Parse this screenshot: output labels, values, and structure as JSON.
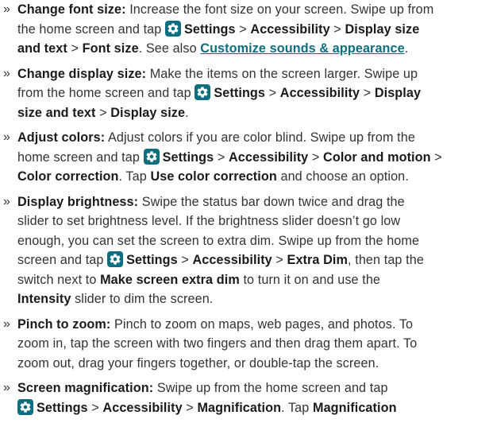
{
  "bullet_glyph": "»",
  "items": [
    {
      "lines": [
        [
          {
            "t": "Change font size:",
            "b": true
          },
          {
            "t": " Increase the font size on your screen. Swipe up from"
          }
        ],
        [
          {
            "t": "the home screen and tap "
          },
          {
            "icon": "settings-gear-icon"
          },
          {
            "t": "Settings",
            "b": true
          },
          {
            "t": " > "
          },
          {
            "t": "Accessibility",
            "b": true
          },
          {
            "t": " > "
          },
          {
            "t": "Display size",
            "b": true
          }
        ],
        [
          {
            "t": "and text",
            "b": true
          },
          {
            "t": " > "
          },
          {
            "t": "Font size",
            "b": true
          },
          {
            "t": ". See also "
          },
          {
            "t": "Customize sounds & appearance",
            "link": true
          },
          {
            "t": "."
          }
        ]
      ]
    },
    {
      "lines": [
        [
          {
            "t": "Change display size:",
            "b": true
          },
          {
            "t": " Make the items on the screen larger. Swipe up"
          }
        ],
        [
          {
            "t": "from the home screen and tap "
          },
          {
            "icon": "settings-gear-icon"
          },
          {
            "t": "Settings",
            "b": true
          },
          {
            "t": " > "
          },
          {
            "t": "Accessibility",
            "b": true
          },
          {
            "t": " > "
          },
          {
            "t": "Display",
            "b": true
          }
        ],
        [
          {
            "t": "size and text",
            "b": true
          },
          {
            "t": " > "
          },
          {
            "t": "Display size",
            "b": true
          },
          {
            "t": "."
          }
        ]
      ]
    },
    {
      "lines": [
        [
          {
            "t": "Adjust colors:",
            "b": true
          },
          {
            "t": " Adjust colors if you are color blind. Swipe up from the"
          }
        ],
        [
          {
            "t": "home screen and tap "
          },
          {
            "icon": "settings-gear-icon"
          },
          {
            "t": "Settings",
            "b": true
          },
          {
            "t": " > "
          },
          {
            "t": "Accessibility",
            "b": true
          },
          {
            "t": " > "
          },
          {
            "t": "Color and motion",
            "b": true
          },
          {
            "t": " >"
          }
        ],
        [
          {
            "t": "Color correction",
            "b": true
          },
          {
            "t": ". Tap "
          },
          {
            "t": "Use color correction",
            "b": true
          },
          {
            "t": " and choose an option."
          }
        ]
      ]
    },
    {
      "lines": [
        [
          {
            "t": "Display brightness:",
            "b": true
          },
          {
            "t": " Swipe the status bar down twice and drag the"
          }
        ],
        [
          {
            "t": "slider to set brightness level. If the brightness slider doesn’t go low"
          }
        ],
        [
          {
            "t": "enough, you can set the screen to extra dim. Swipe up from the home"
          }
        ],
        [
          {
            "t": "screen and tap "
          },
          {
            "icon": "settings-gear-icon"
          },
          {
            "t": "Settings",
            "b": true
          },
          {
            "t": " > "
          },
          {
            "t": "Accessibility",
            "b": true
          },
          {
            "t": " > "
          },
          {
            "t": "Extra Dim",
            "b": true
          },
          {
            "t": ", then tap the"
          }
        ],
        [
          {
            "t": "switch next to "
          },
          {
            "t": "Make screen extra dim",
            "b": true
          },
          {
            "t": " to turn it on and use the"
          }
        ],
        [
          {
            "t": "Intensity",
            "b": true
          },
          {
            "t": " slider to dim the screen."
          }
        ]
      ]
    },
    {
      "lines": [
        [
          {
            "t": "Pinch to zoom:",
            "b": true
          },
          {
            "t": " Pinch to zoom on maps, web pages, and photos. To"
          }
        ],
        [
          {
            "t": "zoom in, tap the screen with two fingers and then drag them apart. To"
          }
        ],
        [
          {
            "t": "zoom out, drag your fingers together, or double-tap the screen."
          }
        ]
      ]
    },
    {
      "lines": [
        [
          {
            "t": "Screen magnification:",
            "b": true
          },
          {
            "t": " Swipe up from the home screen and tap"
          }
        ],
        [
          {
            "icon": "settings-gear-icon"
          },
          {
            "t": "Settings",
            "b": true
          },
          {
            "t": " > "
          },
          {
            "t": "Accessibility",
            "b": true
          },
          {
            "t": " > "
          },
          {
            "t": "Magnification",
            "b": true
          },
          {
            "t": ". Tap "
          },
          {
            "t": "Magnification",
            "b": true
          }
        ]
      ]
    }
  ]
}
